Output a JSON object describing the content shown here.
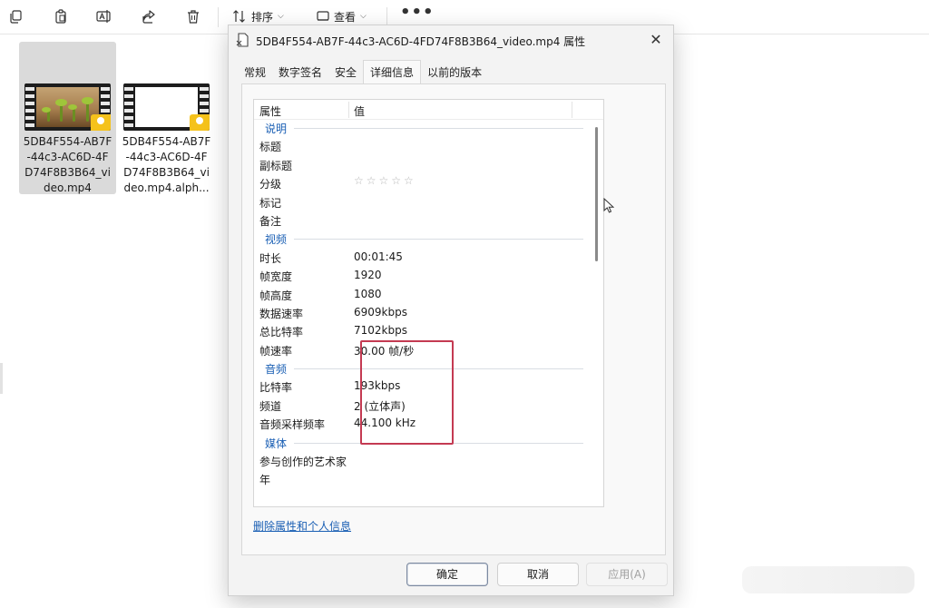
{
  "toolbar": {
    "sort_label": "排序",
    "view_label": "查看",
    "more_label": "•••"
  },
  "files": [
    {
      "name": "5DB4F554-AB7F-44c3-AC6D-4FD74F8B3B64_video.mp4",
      "display": "5DB4F554-AB7F\n-44c3-AC6D-4F\nD74F8B3B64_vi\ndeo.mp4",
      "selected": true
    },
    {
      "name": "5DB4F554-AB7F-44c3-AC6D-4FD74F8B3B64_video.mp4.alph...",
      "display": "5DB4F554-AB7F\n-44c3-AC6D-4F\nD74F8B3B64_vi\ndeo.mp4.alph...",
      "selected": false
    }
  ],
  "dialog": {
    "title": "5DB4F554-AB7F-44c3-AC6D-4FD74F8B3B64_video.mp4 属性",
    "tabs": [
      "常规",
      "数字签名",
      "安全",
      "详细信息",
      "以前的版本"
    ],
    "active_tab": "详细信息",
    "columns": {
      "property": "属性",
      "value": "值"
    },
    "rows": [
      {
        "type": "group",
        "label": "说明"
      },
      {
        "key": "标题",
        "value": ""
      },
      {
        "key": "副标题",
        "value": ""
      },
      {
        "key": "分级",
        "value": "☆☆☆☆☆"
      },
      {
        "key": "标记",
        "value": ""
      },
      {
        "key": "备注",
        "value": ""
      },
      {
        "type": "group",
        "label": "视频"
      },
      {
        "key": "时长",
        "value": "00:01:45"
      },
      {
        "key": "帧宽度",
        "value": "1920"
      },
      {
        "key": "帧高度",
        "value": "1080"
      },
      {
        "key": "数据速率",
        "value": "6909kbps"
      },
      {
        "key": "总比特率",
        "value": "7102kbps"
      },
      {
        "key": "帧速率",
        "value": "30.00 帧/秒"
      },
      {
        "type": "group",
        "label": "音频"
      },
      {
        "key": "比特率",
        "value": "193kbps"
      },
      {
        "key": "频道",
        "value": "2 (立体声)"
      },
      {
        "key": "音频采样频率",
        "value": "44.100 kHz"
      },
      {
        "type": "group",
        "label": "媒体"
      },
      {
        "key": "参与创作的艺术家",
        "value": ""
      },
      {
        "key": "年",
        "value": ""
      }
    ],
    "remove_link": "删除属性和个人信息",
    "buttons": {
      "ok": "确定",
      "cancel": "取消",
      "apply": "应用(A)"
    },
    "highlight_color": "#c43a52",
    "link_color": "#1a5fb4"
  }
}
